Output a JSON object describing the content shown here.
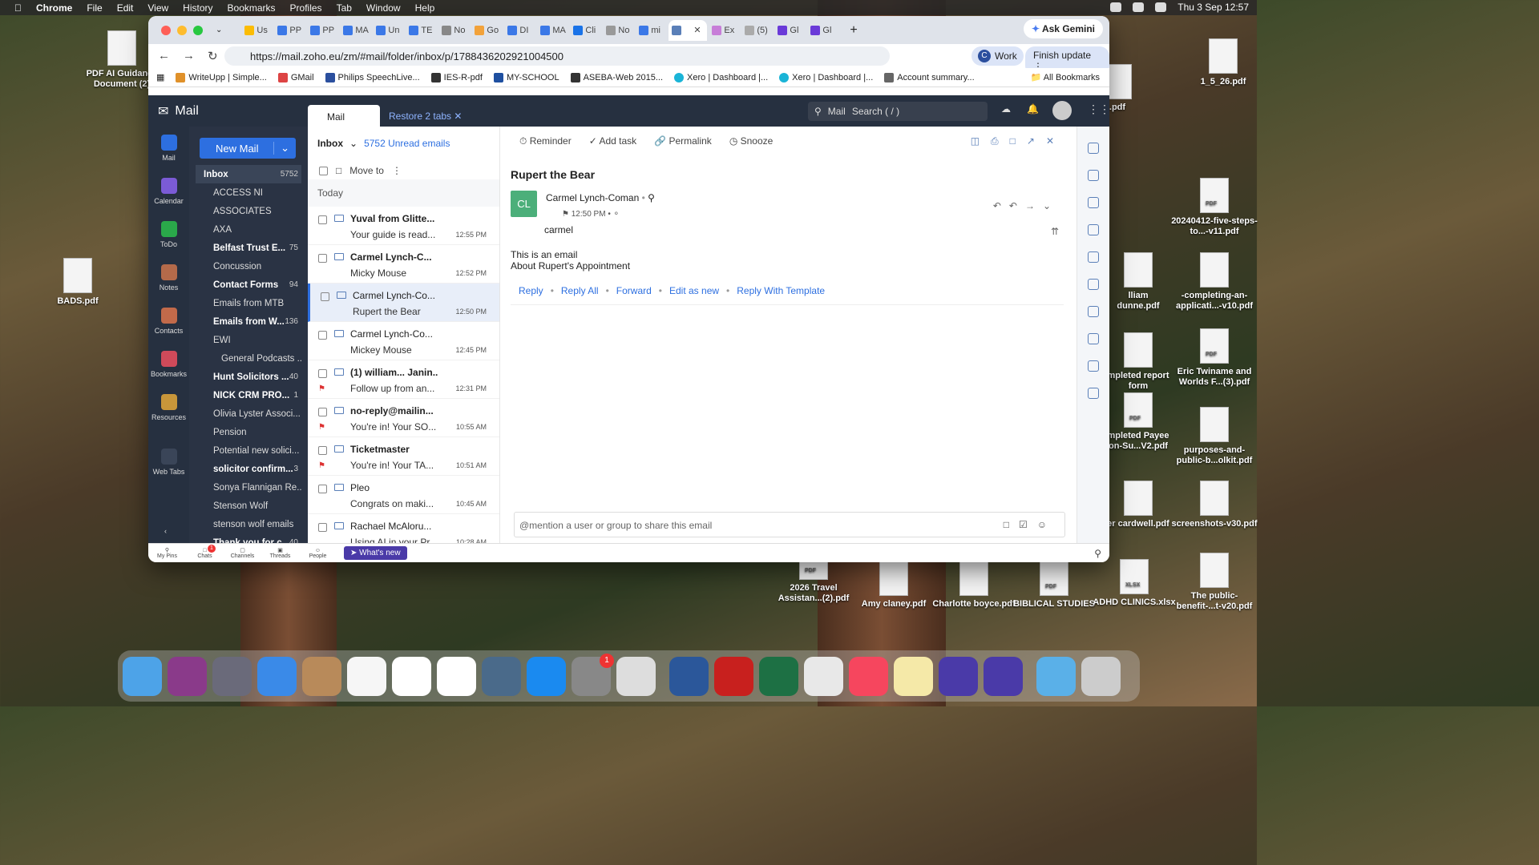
{
  "menubar": {
    "app": "Chrome",
    "items": [
      "File",
      "Edit",
      "View",
      "History",
      "Bookmarks",
      "Profiles",
      "Tab",
      "Window",
      "Help"
    ],
    "clock": "Thu 3 Sep  12:57"
  },
  "desktop": {
    "icons": [
      {
        "label": "PDF AI Guidance Document (2)"
      },
      {
        "label": "BADS.pdf"
      },
      {
        "label": "1_5_26.pdf"
      },
      {
        "label": ".pdf"
      },
      {
        "label": "20240412-five-steps-to...-v11.pdf"
      },
      {
        "label": "lliam dunne.pdf"
      },
      {
        "label": "-completing-an-applicati...-v10.pdf"
      },
      {
        "label": "mpleted report form"
      },
      {
        "label": "Eric Twiname and Worlds F...(3).pdf"
      },
      {
        "label": "mpleted Payee on-Su...V2.pdf"
      },
      {
        "label": "purposes-and-public-b...olkit.pdf"
      },
      {
        "label": "er cardwell.pdf"
      },
      {
        "label": "screenshots-v30.pdf"
      },
      {
        "label": "2026 Travel Assistan...(2).pdf"
      },
      {
        "label": "Amy claney.pdf"
      },
      {
        "label": "Charlotte boyce.pdf"
      },
      {
        "label": "BIBLICAL STUDIES"
      },
      {
        "label": "ADHD CLINICS.xlsx"
      },
      {
        "label": "The public-benefit-...t-v20.pdf"
      }
    ]
  },
  "browser": {
    "tabs": [
      "Us",
      "PP",
      "PP",
      "MA",
      "Un",
      "TE",
      "No",
      "Go",
      "DI",
      "MA",
      "Cli",
      "No",
      "mi",
      "",
      "Ex",
      "(5)",
      "Gl",
      "Gl"
    ],
    "ask_gemini": "Ask Gemini",
    "url": "https://mail.zoho.eu/zm/#mail/folder/inbox/p/1788436202921004500",
    "profile": "Work",
    "profile_initial": "C",
    "finish_update": "Finish update",
    "bookmarks": [
      "WriteUpp | Simple...",
      "GMail",
      "Philips SpeechLive...",
      "IES-R-pdf",
      "MY-SCHOOL",
      "ASEBA-Web 2015...",
      "Xero | Dashboard |...",
      "Xero | Dashboard |...",
      "Account summary..."
    ],
    "all_bookmarks": "All Bookmarks"
  },
  "zoho": {
    "app_name": "Mail",
    "tab_mail": "Mail",
    "restore_tabs": "Restore 2 tabs",
    "search_scope": "Mail",
    "search_placeholder": "Search ( / )",
    "rail": [
      "Mail",
      "Calendar",
      "ToDo",
      "Notes",
      "Contacts",
      "Bookmarks",
      "Resources",
      "Web Tabs"
    ],
    "new_mail": "New Mail",
    "folders": [
      {
        "name": "Inbox",
        "count": "5752",
        "unread": true,
        "type": "inbox"
      },
      {
        "name": "ACCESS NI",
        "count": "",
        "unread": false,
        "type": "f"
      },
      {
        "name": "ASSOCIATES",
        "count": "",
        "unread": false,
        "type": "f"
      },
      {
        "name": "AXA",
        "count": "",
        "unread": false,
        "type": "f"
      },
      {
        "name": "Belfast Trust E...",
        "count": "75",
        "unread": true,
        "type": "f"
      },
      {
        "name": "Concussion",
        "count": "",
        "unread": false,
        "type": "f"
      },
      {
        "name": "Contact Forms",
        "count": "94",
        "unread": true,
        "type": "f"
      },
      {
        "name": "Emails from MTB",
        "count": "",
        "unread": false,
        "type": "f"
      },
      {
        "name": "Emails from W...",
        "count": "136",
        "unread": true,
        "type": "f"
      },
      {
        "name": "EWI",
        "count": "",
        "unread": false,
        "type": "f"
      },
      {
        "name": "General Podcasts ...",
        "count": "",
        "unread": false,
        "type": "sub"
      },
      {
        "name": "Hunt Solicitors ...",
        "count": "40",
        "unread": true,
        "type": "f"
      },
      {
        "name": "NICK CRM PRO...",
        "count": "1",
        "unread": true,
        "type": "f"
      },
      {
        "name": "Olivia Lyster Associ...",
        "count": "",
        "unread": false,
        "type": "f"
      },
      {
        "name": "Pension",
        "count": "",
        "unread": false,
        "type": "f"
      },
      {
        "name": "Potential new solici...",
        "count": "",
        "unread": false,
        "type": "f"
      },
      {
        "name": "solicitor confirm...",
        "count": "3",
        "unread": true,
        "type": "f"
      },
      {
        "name": "Sonya Flannigan Re...",
        "count": "",
        "unread": false,
        "type": "f"
      },
      {
        "name": "Stenson Wolf",
        "count": "",
        "unread": false,
        "type": "f"
      },
      {
        "name": "stenson wolf emails",
        "count": "",
        "unread": false,
        "type": "f"
      },
      {
        "name": "Thank you for c...",
        "count": "40",
        "unread": true,
        "type": "f"
      }
    ],
    "list": {
      "folder": "Inbox",
      "unread": "5752 Unread emails",
      "move_to": "Move to",
      "group": "Today",
      "messages": [
        {
          "from": "Yuval from Glitte...",
          "subject": "Your guide is read...",
          "time": "12:55 PM",
          "unread": true,
          "selected": false,
          "flag": false
        },
        {
          "from": "Carmel Lynch-C...",
          "subject": "Micky Mouse",
          "time": "12:52 PM",
          "unread": true,
          "selected": false,
          "flag": false
        },
        {
          "from": "Carmel Lynch-Co...",
          "subject": "Rupert the Bear",
          "time": "12:50 PM",
          "unread": false,
          "selected": true,
          "flag": false
        },
        {
          "from": "Carmel Lynch-Co...",
          "subject": "Mickey Mouse",
          "time": "12:45 PM",
          "unread": false,
          "selected": false,
          "flag": false
        },
        {
          "from": "(1) william... Janin...",
          "subject": "Follow up from an...",
          "time": "12:31 PM",
          "unread": true,
          "selected": false,
          "flag": true
        },
        {
          "from": "no-reply@mailin...",
          "subject": "You're in! Your SO...",
          "time": "10:55 AM",
          "unread": true,
          "selected": false,
          "flag": true
        },
        {
          "from": "Ticketmaster",
          "subject": "You're in! Your TA...",
          "time": "10:51 AM",
          "unread": true,
          "selected": false,
          "flag": true
        },
        {
          "from": "Pleo",
          "subject": "Congrats on maki...",
          "time": "10:45 AM",
          "unread": false,
          "selected": false,
          "flag": false
        },
        {
          "from": "Rachael McAloru...",
          "subject": "Using AI in your Pr...",
          "time": "10:28 AM",
          "unread": false,
          "selected": false,
          "flag": false
        }
      ]
    },
    "reader": {
      "toolbar": [
        "Reminder",
        "Add task",
        "Permalink",
        "Snooze"
      ],
      "subject": "Rupert the Bear",
      "avatar": "CL",
      "sender": "Carmel Lynch-Coman",
      "time": "12:50 PM",
      "to": "carmel",
      "body_line1": "This is an email",
      "body_line2": "About Rupert's Appointment",
      "actions": [
        "Reply",
        "Reply All",
        "Forward",
        "Edit as new",
        "Reply With Template"
      ],
      "mention_placeholder": "@mention a user or group to share this email"
    },
    "bottom": [
      "My Pins",
      "Chats",
      "Channels",
      "Threads",
      "People"
    ],
    "chats_badge": "1",
    "whats_new": "What's new"
  },
  "dock": {
    "settings_badge": "1"
  }
}
